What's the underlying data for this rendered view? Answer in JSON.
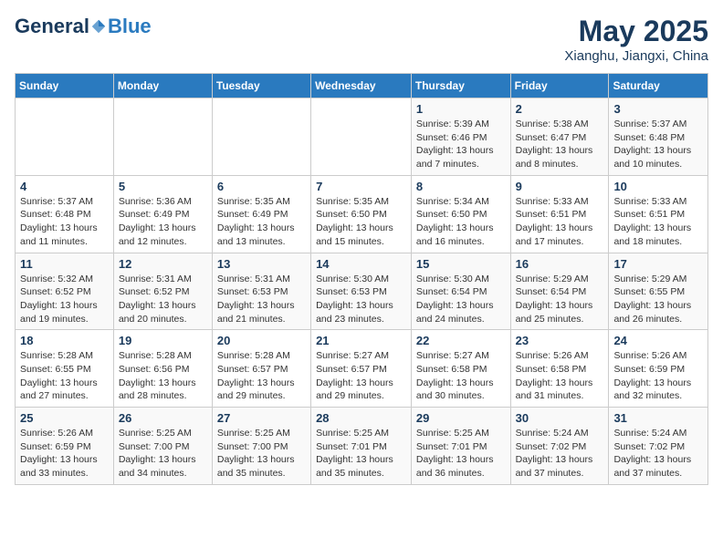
{
  "logo": {
    "general": "General",
    "blue": "Blue"
  },
  "title": "May 2025",
  "location": "Xianghu, Jiangxi, China",
  "days_header": [
    "Sunday",
    "Monday",
    "Tuesday",
    "Wednesday",
    "Thursday",
    "Friday",
    "Saturday"
  ],
  "weeks": [
    [
      {
        "day": "",
        "detail": ""
      },
      {
        "day": "",
        "detail": ""
      },
      {
        "day": "",
        "detail": ""
      },
      {
        "day": "",
        "detail": ""
      },
      {
        "day": "1",
        "detail": "Sunrise: 5:39 AM\nSunset: 6:46 PM\nDaylight: 13 hours\nand 7 minutes."
      },
      {
        "day": "2",
        "detail": "Sunrise: 5:38 AM\nSunset: 6:47 PM\nDaylight: 13 hours\nand 8 minutes."
      },
      {
        "day": "3",
        "detail": "Sunrise: 5:37 AM\nSunset: 6:48 PM\nDaylight: 13 hours\nand 10 minutes."
      }
    ],
    [
      {
        "day": "4",
        "detail": "Sunrise: 5:37 AM\nSunset: 6:48 PM\nDaylight: 13 hours\nand 11 minutes."
      },
      {
        "day": "5",
        "detail": "Sunrise: 5:36 AM\nSunset: 6:49 PM\nDaylight: 13 hours\nand 12 minutes."
      },
      {
        "day": "6",
        "detail": "Sunrise: 5:35 AM\nSunset: 6:49 PM\nDaylight: 13 hours\nand 13 minutes."
      },
      {
        "day": "7",
        "detail": "Sunrise: 5:35 AM\nSunset: 6:50 PM\nDaylight: 13 hours\nand 15 minutes."
      },
      {
        "day": "8",
        "detail": "Sunrise: 5:34 AM\nSunset: 6:50 PM\nDaylight: 13 hours\nand 16 minutes."
      },
      {
        "day": "9",
        "detail": "Sunrise: 5:33 AM\nSunset: 6:51 PM\nDaylight: 13 hours\nand 17 minutes."
      },
      {
        "day": "10",
        "detail": "Sunrise: 5:33 AM\nSunset: 6:51 PM\nDaylight: 13 hours\nand 18 minutes."
      }
    ],
    [
      {
        "day": "11",
        "detail": "Sunrise: 5:32 AM\nSunset: 6:52 PM\nDaylight: 13 hours\nand 19 minutes."
      },
      {
        "day": "12",
        "detail": "Sunrise: 5:31 AM\nSunset: 6:52 PM\nDaylight: 13 hours\nand 20 minutes."
      },
      {
        "day": "13",
        "detail": "Sunrise: 5:31 AM\nSunset: 6:53 PM\nDaylight: 13 hours\nand 21 minutes."
      },
      {
        "day": "14",
        "detail": "Sunrise: 5:30 AM\nSunset: 6:53 PM\nDaylight: 13 hours\nand 23 minutes."
      },
      {
        "day": "15",
        "detail": "Sunrise: 5:30 AM\nSunset: 6:54 PM\nDaylight: 13 hours\nand 24 minutes."
      },
      {
        "day": "16",
        "detail": "Sunrise: 5:29 AM\nSunset: 6:54 PM\nDaylight: 13 hours\nand 25 minutes."
      },
      {
        "day": "17",
        "detail": "Sunrise: 5:29 AM\nSunset: 6:55 PM\nDaylight: 13 hours\nand 26 minutes."
      }
    ],
    [
      {
        "day": "18",
        "detail": "Sunrise: 5:28 AM\nSunset: 6:55 PM\nDaylight: 13 hours\nand 27 minutes."
      },
      {
        "day": "19",
        "detail": "Sunrise: 5:28 AM\nSunset: 6:56 PM\nDaylight: 13 hours\nand 28 minutes."
      },
      {
        "day": "20",
        "detail": "Sunrise: 5:28 AM\nSunset: 6:57 PM\nDaylight: 13 hours\nand 29 minutes."
      },
      {
        "day": "21",
        "detail": "Sunrise: 5:27 AM\nSunset: 6:57 PM\nDaylight: 13 hours\nand 29 minutes."
      },
      {
        "day": "22",
        "detail": "Sunrise: 5:27 AM\nSunset: 6:58 PM\nDaylight: 13 hours\nand 30 minutes."
      },
      {
        "day": "23",
        "detail": "Sunrise: 5:26 AM\nSunset: 6:58 PM\nDaylight: 13 hours\nand 31 minutes."
      },
      {
        "day": "24",
        "detail": "Sunrise: 5:26 AM\nSunset: 6:59 PM\nDaylight: 13 hours\nand 32 minutes."
      }
    ],
    [
      {
        "day": "25",
        "detail": "Sunrise: 5:26 AM\nSunset: 6:59 PM\nDaylight: 13 hours\nand 33 minutes."
      },
      {
        "day": "26",
        "detail": "Sunrise: 5:25 AM\nSunset: 7:00 PM\nDaylight: 13 hours\nand 34 minutes."
      },
      {
        "day": "27",
        "detail": "Sunrise: 5:25 AM\nSunset: 7:00 PM\nDaylight: 13 hours\nand 35 minutes."
      },
      {
        "day": "28",
        "detail": "Sunrise: 5:25 AM\nSunset: 7:01 PM\nDaylight: 13 hours\nand 35 minutes."
      },
      {
        "day": "29",
        "detail": "Sunrise: 5:25 AM\nSunset: 7:01 PM\nDaylight: 13 hours\nand 36 minutes."
      },
      {
        "day": "30",
        "detail": "Sunrise: 5:24 AM\nSunset: 7:02 PM\nDaylight: 13 hours\nand 37 minutes."
      },
      {
        "day": "31",
        "detail": "Sunrise: 5:24 AM\nSunset: 7:02 PM\nDaylight: 13 hours\nand 37 minutes."
      }
    ]
  ]
}
